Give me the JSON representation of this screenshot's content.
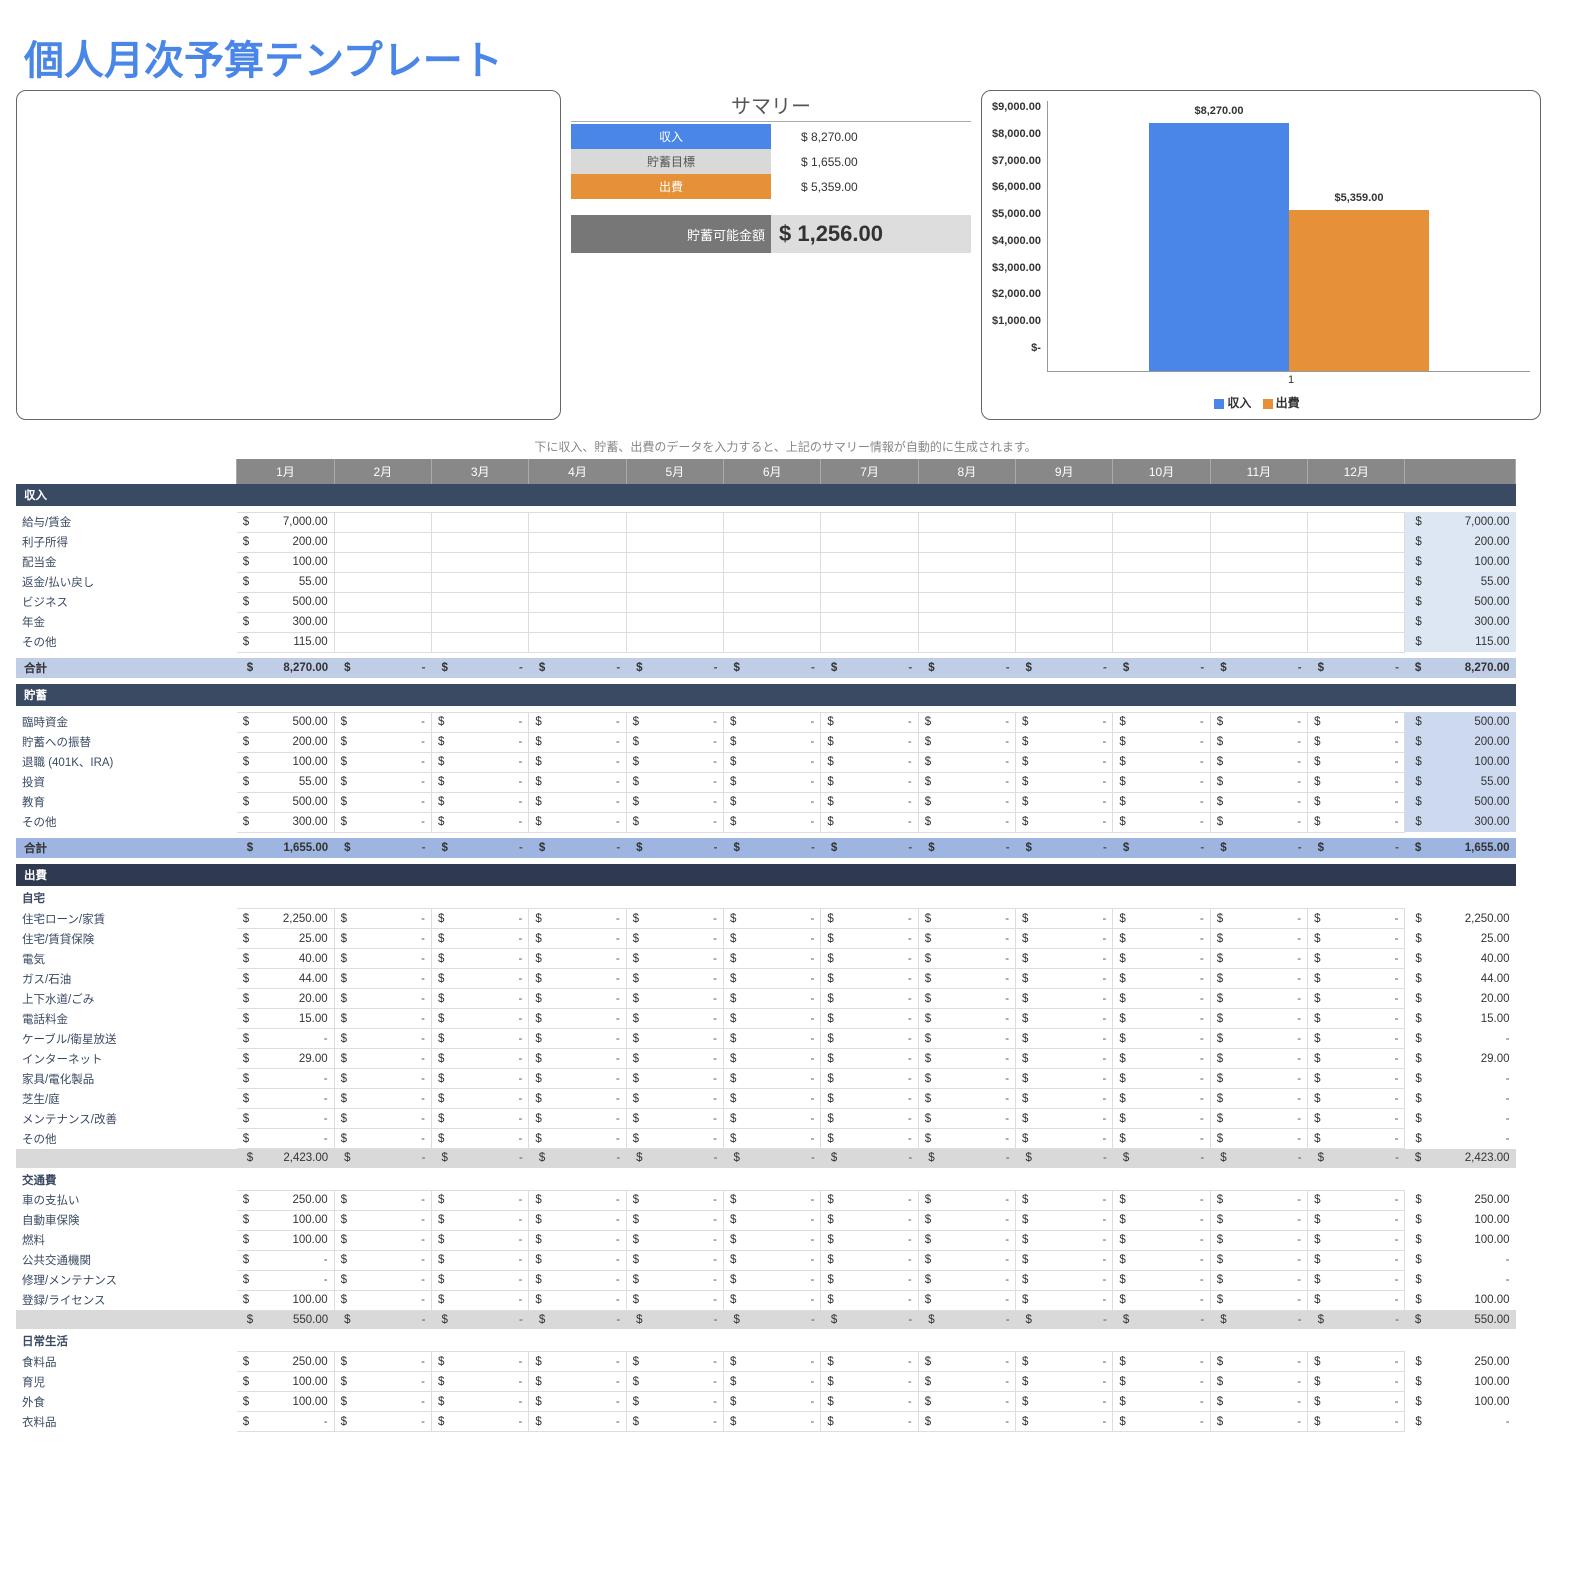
{
  "title": "個人月次予算テンプレート",
  "summary": {
    "heading": "サマリー",
    "income_label": "収入",
    "income_value": "$  8,270.00",
    "savings_goal_label": "貯蓄目標",
    "savings_goal_value": "$  1,655.00",
    "expense_label": "出費",
    "expense_value": "$  5,359.00",
    "available_label": "貯蓄可能金額",
    "available_value": "$ 1,256.00",
    "colors": {
      "income": "#4a86e8",
      "savings": "#d9d9d9",
      "expense": "#e69138"
    }
  },
  "chart_data": {
    "type": "bar",
    "categories": [
      "1"
    ],
    "series": [
      {
        "name": "収入",
        "values": [
          8270
        ],
        "color": "#4a86e8",
        "label": "$8,270.00"
      },
      {
        "name": "出費",
        "values": [
          5359
        ],
        "color": "#e69138",
        "label": "$5,359.00"
      }
    ],
    "ylim": [
      0,
      9000
    ],
    "yticks": [
      "$9,000.00",
      "$8,000.00",
      "$7,000.00",
      "$6,000.00",
      "$5,000.00",
      "$4,000.00",
      "$3,000.00",
      "$2,000.00",
      "$1,000.00",
      "$-"
    ],
    "legend": [
      "収入",
      "出費"
    ]
  },
  "note": "下に収入、貯蓄、出費のデータを入力すると、上記のサマリー情報が自動的に生成されます。",
  "months": [
    "1月",
    "2月",
    "3月",
    "4月",
    "5月",
    "6月",
    "7月",
    "8月",
    "9月",
    "10月",
    "11月",
    "12月"
  ],
  "sections": {
    "income": {
      "heading": "収入",
      "rows": [
        {
          "label": "給与/賃金",
          "m1": "7,000.00",
          "total": "7,000.00"
        },
        {
          "label": "利子所得",
          "m1": "200.00",
          "total": "200.00"
        },
        {
          "label": "配当金",
          "m1": "100.00",
          "total": "100.00"
        },
        {
          "label": "返金/払い戻し",
          "m1": "55.00",
          "total": "55.00"
        },
        {
          "label": "ビジネス",
          "m1": "500.00",
          "total": "500.00"
        },
        {
          "label": "年金",
          "m1": "300.00",
          "total": "300.00"
        },
        {
          "label": "その他",
          "m1": "115.00",
          "total": "115.00"
        }
      ],
      "subtotal_label": "合計",
      "subtotal_m1": "8,270.00",
      "subtotal_total": "8,270.00"
    },
    "savings": {
      "heading": "貯蓄",
      "rows": [
        {
          "label": "臨時資金",
          "m1": "500.00",
          "total": "500.00"
        },
        {
          "label": "貯蓄への振替",
          "m1": "200.00",
          "total": "200.00"
        },
        {
          "label": "退職 (401K、IRA)",
          "m1": "100.00",
          "total": "100.00"
        },
        {
          "label": "投資",
          "m1": "55.00",
          "total": "55.00"
        },
        {
          "label": "教育",
          "m1": "500.00",
          "total": "500.00"
        },
        {
          "label": "その他",
          "m1": "300.00",
          "total": "300.00"
        }
      ],
      "subtotal_label": "合計",
      "subtotal_m1": "1,655.00",
      "subtotal_total": "1,655.00"
    },
    "expense": {
      "heading": "出費",
      "groups": [
        {
          "subhead": "自宅",
          "rows": [
            {
              "label": "住宅ローン/家賃",
              "m1": "2,250.00",
              "total": "2,250.00"
            },
            {
              "label": "住宅/賃貸保険",
              "m1": "25.00",
              "total": "25.00"
            },
            {
              "label": "電気",
              "m1": "40.00",
              "total": "40.00"
            },
            {
              "label": "ガス/石油",
              "m1": "44.00",
              "total": "44.00"
            },
            {
              "label": "上下水道/ごみ",
              "m1": "20.00",
              "total": "20.00"
            },
            {
              "label": "電話料金",
              "m1": "15.00",
              "total": "15.00"
            },
            {
              "label": "ケーブル/衛星放送",
              "m1": "-",
              "total": "-"
            },
            {
              "label": "インターネット",
              "m1": "29.00",
              "total": "29.00"
            },
            {
              "label": "家具/電化製品",
              "m1": "-",
              "total": "-"
            },
            {
              "label": "芝生/庭",
              "m1": "-",
              "total": "-"
            },
            {
              "label": "メンテナンス/改善",
              "m1": "-",
              "total": "-"
            },
            {
              "label": "その他",
              "m1": "-",
              "total": "-"
            }
          ],
          "subtotal_m1": "2,423.00",
          "subtotal_total": "2,423.00"
        },
        {
          "subhead": "交通費",
          "rows": [
            {
              "label": "車の支払い",
              "m1": "250.00",
              "total": "250.00"
            },
            {
              "label": "自動車保険",
              "m1": "100.00",
              "total": "100.00"
            },
            {
              "label": "燃料",
              "m1": "100.00",
              "total": "100.00"
            },
            {
              "label": "公共交通機関",
              "m1": "-",
              "total": "-"
            },
            {
              "label": "修理/メンテナンス",
              "m1": "-",
              "total": "-"
            },
            {
              "label": "登録/ライセンス",
              "m1": "100.00",
              "total": "100.00"
            }
          ],
          "subtotal_m1": "550.00",
          "subtotal_total": "550.00"
        },
        {
          "subhead": "日常生活",
          "rows": [
            {
              "label": "食料品",
              "m1": "250.00",
              "total": "250.00"
            },
            {
              "label": "育児",
              "m1": "100.00",
              "total": "100.00"
            },
            {
              "label": "外食",
              "m1": "100.00",
              "total": "100.00"
            },
            {
              "label": "衣料品",
              "m1": "-",
              "total": "-"
            }
          ]
        }
      ]
    }
  }
}
